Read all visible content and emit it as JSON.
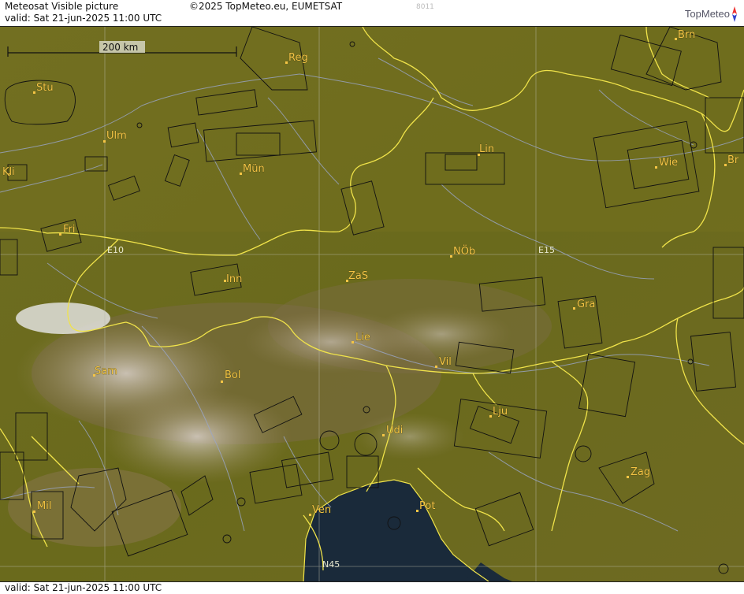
{
  "header": {
    "title": "Meteosat Visible picture",
    "copyright": "©2025 TopMeteo.eu, EUMETSAT",
    "valid": "valid:  Sat  21-jun-2025  11:00 UTC",
    "code": "8011",
    "logo": "TopMeteo"
  },
  "footer": {
    "valid": "valid:  Sat  21-jun-2025  11:00 UTC"
  },
  "scale": {
    "label": "200 km"
  },
  "grid_labels": {
    "e10": "E10",
    "e15": "E15",
    "n45": "N45"
  },
  "cities": [
    {
      "name": "Brn"
    },
    {
      "name": "Reg"
    },
    {
      "name": "Stu"
    },
    {
      "name": "Ulm"
    },
    {
      "name": "Lin"
    },
    {
      "name": "Mün"
    },
    {
      "name": "Wie"
    },
    {
      "name": "Br"
    },
    {
      "name": "Kli"
    },
    {
      "name": "Fri"
    },
    {
      "name": "NÖb"
    },
    {
      "name": "Inn"
    },
    {
      "name": "ZaS"
    },
    {
      "name": "Gra"
    },
    {
      "name": "Lie"
    },
    {
      "name": "Vil"
    },
    {
      "name": "Sam"
    },
    {
      "name": "Bol"
    },
    {
      "name": "Lju"
    },
    {
      "name": "Udi"
    },
    {
      "name": "Zag"
    },
    {
      "name": "Mil"
    },
    {
      "name": "Ven"
    },
    {
      "name": "Pot"
    }
  ],
  "colors": {
    "terrain": "#6b6a1e",
    "border": "#f0e34a",
    "label": "#f5c545",
    "sea": "#1a2a3a"
  }
}
